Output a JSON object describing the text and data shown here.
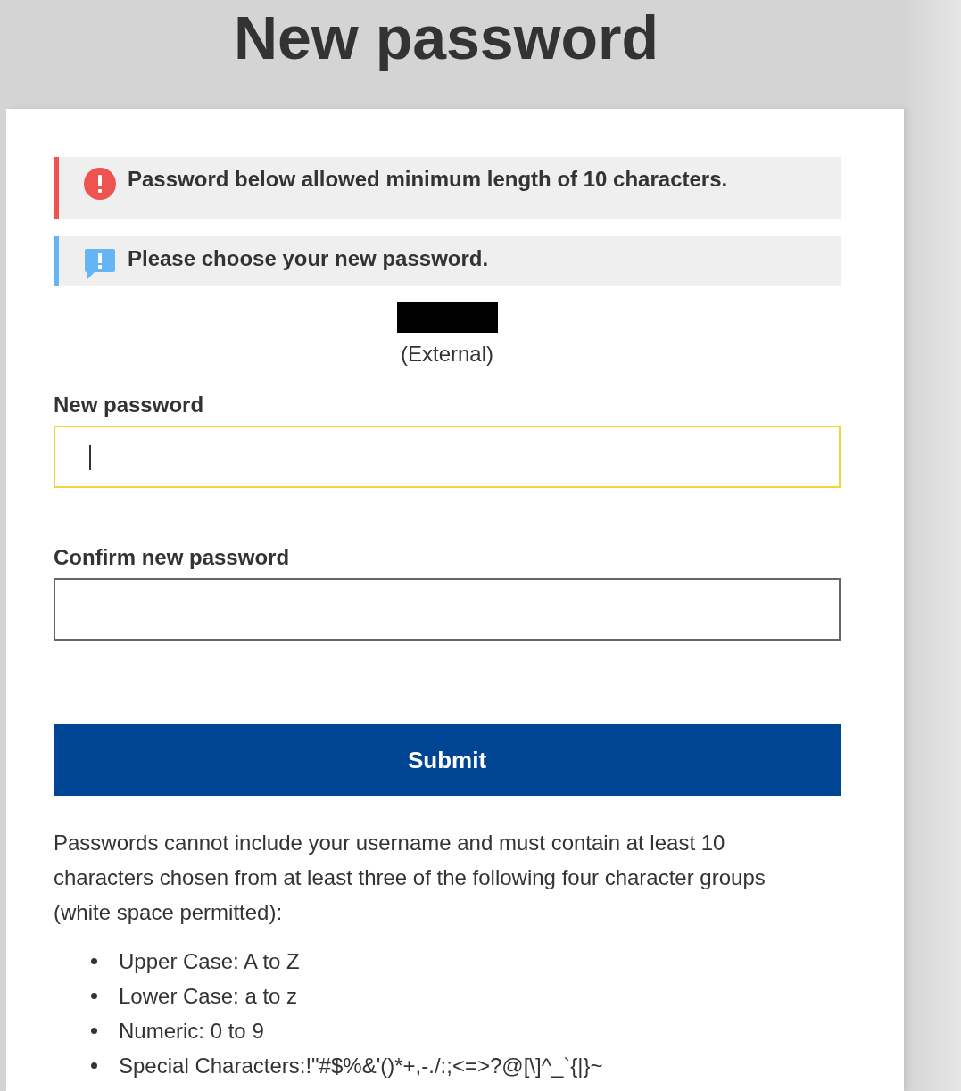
{
  "page": {
    "title": "New password"
  },
  "alerts": [
    {
      "kind": "error",
      "text": "Password below allowed minimum length of 10 characters."
    },
    {
      "kind": "info",
      "text": "Please choose your new password."
    }
  ],
  "account": {
    "redacted": true,
    "note": "(External)"
  },
  "fields": [
    {
      "label": "New password",
      "focused": true
    },
    {
      "label": "Confirm new password",
      "focused": false
    }
  ],
  "submit_button": "Submit",
  "rules": {
    "intro": "Passwords cannot include your username and must contain at least 10 characters chosen from at least three of the following four character groups (white space permitted):",
    "items": [
      "Upper Case: A to Z",
      "Lower Case: a to z",
      "Numeric: 0 to 9",
      "Special Characters:!\"#$%&'()*+,-./:;<=>?@[\\]^_`{|}~"
    ]
  }
}
